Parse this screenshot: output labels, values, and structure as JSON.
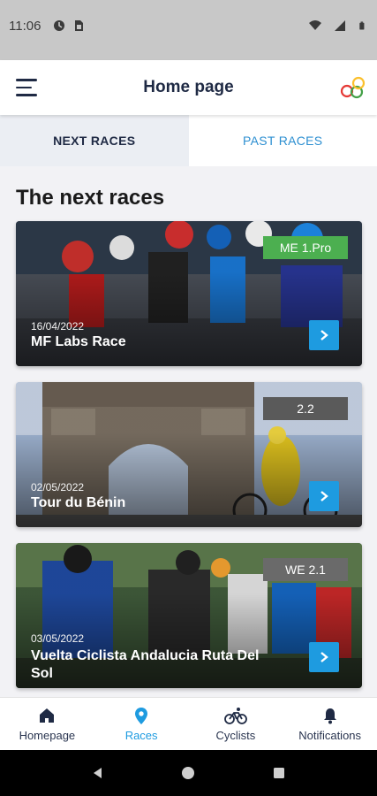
{
  "status_bar": {
    "time": "11:06"
  },
  "header": {
    "title": "Home page",
    "menu_icon": "hamburger-menu-icon",
    "logo_icon": "colored-rings-logo"
  },
  "tabs": [
    {
      "label": "NEXT RACES",
      "active": true
    },
    {
      "label": "PAST RACES",
      "active": false
    }
  ],
  "section": {
    "title": "The next races"
  },
  "races": [
    {
      "date": "16/04/2022",
      "name": "MF Labs Race",
      "badge": "ME 1.Pro",
      "badge_color": "#4caf50"
    },
    {
      "date": "02/05/2022",
      "name": "Tour du Bénin",
      "badge": "2.2",
      "badge_color": "#5a5a5a"
    },
    {
      "date": "03/05/2022",
      "name": "Vuelta Ciclista Andalucia Ruta Del Sol",
      "badge": "WE 2.1",
      "badge_color": "#6a6a6a"
    }
  ],
  "bottom_nav": [
    {
      "label": "Homepage",
      "icon": "home-icon",
      "active": false
    },
    {
      "label": "Races",
      "icon": "location-pin-icon",
      "active": true
    },
    {
      "label": "Cyclists",
      "icon": "bicycle-icon",
      "active": false
    },
    {
      "label": "Notifications",
      "icon": "bell-icon",
      "active": false
    }
  ],
  "colors": {
    "accent": "#1e9be0",
    "title_dark": "#1f2a44"
  }
}
